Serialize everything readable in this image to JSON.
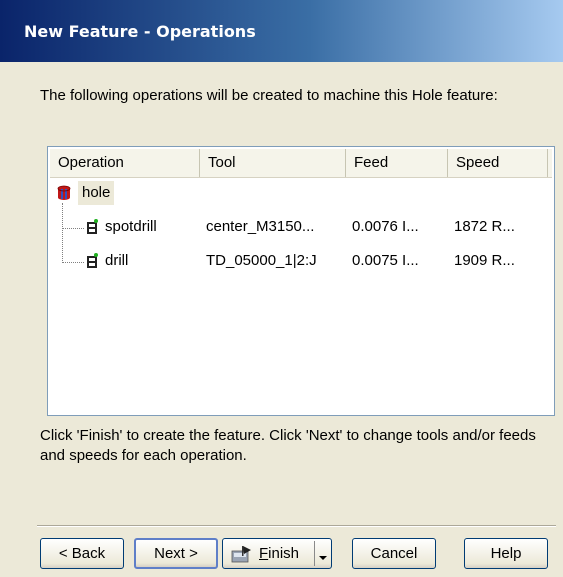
{
  "window": {
    "title": "New Feature - Operations"
  },
  "intro_text": "The following operations will be created to machine this Hole feature:",
  "operations_list": {
    "columns": [
      "Operation",
      "Tool",
      "Feed",
      "Speed"
    ],
    "root": {
      "label": "hole",
      "icon": "hole-feature-icon"
    },
    "rows": [
      {
        "operation": "spotdrill",
        "tool": "center_M3150...",
        "feed": "0.0076 I...",
        "speed": "1872 R...",
        "icon": "operation-icon"
      },
      {
        "operation": "drill",
        "tool": "TD_05000_1|2:J",
        "feed": "0.0075 I...",
        "speed": "1909 R...",
        "icon": "operation-icon"
      }
    ]
  },
  "hint_text": "Click 'Finish' to create the feature.  Click 'Next' to change tools and/or feeds and speeds for each operation.",
  "buttons": {
    "back": "< Back",
    "next": "Next >",
    "finish_prefix": "",
    "finish_underline": "F",
    "finish_rest": "inish",
    "cancel": "Cancel",
    "help": "Help"
  },
  "colors": {
    "title_gradient_start": "#0a246a",
    "title_gradient_end": "#a6caf0",
    "dialog_bg": "#ece9d8",
    "hole_icon": "#c01818"
  }
}
